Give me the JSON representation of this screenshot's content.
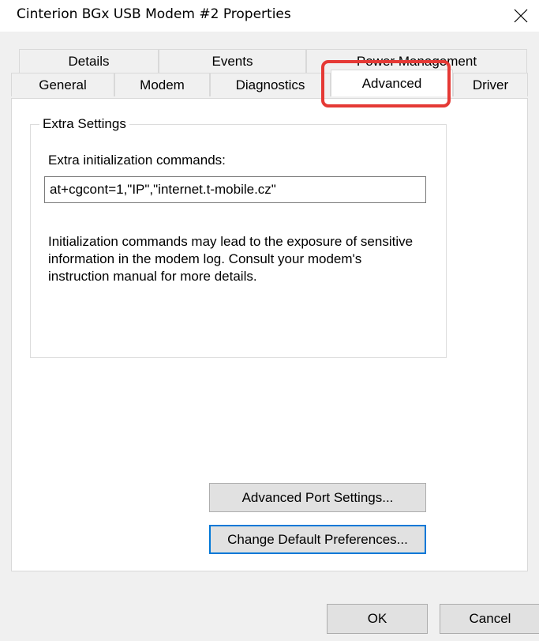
{
  "window": {
    "title": "Cinterion BGx USB Modem #2 Properties",
    "close_icon": "close-icon"
  },
  "tabs": {
    "row1": [
      {
        "label": "Details"
      },
      {
        "label": "Events"
      },
      {
        "label": "Power Management"
      }
    ],
    "row2": [
      {
        "label": "General"
      },
      {
        "label": "Modem"
      },
      {
        "label": "Diagnostics"
      },
      {
        "label": "Advanced",
        "active": true
      },
      {
        "label": "Driver"
      }
    ]
  },
  "extra_settings": {
    "group_label": "Extra Settings",
    "field_label": "Extra initialization commands:",
    "field_value": "at+cgcont=1,\"IP\",\"internet.t-mobile.cz\"",
    "info_text": "Initialization commands may lead to the exposure of sensitive information in the modem log. Consult your modem's instruction manual for more details."
  },
  "buttons": {
    "advanced_port_settings": "Advanced Port Settings...",
    "change_default_preferences": "Change Default Preferences...",
    "ok": "OK",
    "cancel": "Cancel"
  },
  "colors": {
    "highlight": "#e53935",
    "focus": "#0078d7"
  }
}
